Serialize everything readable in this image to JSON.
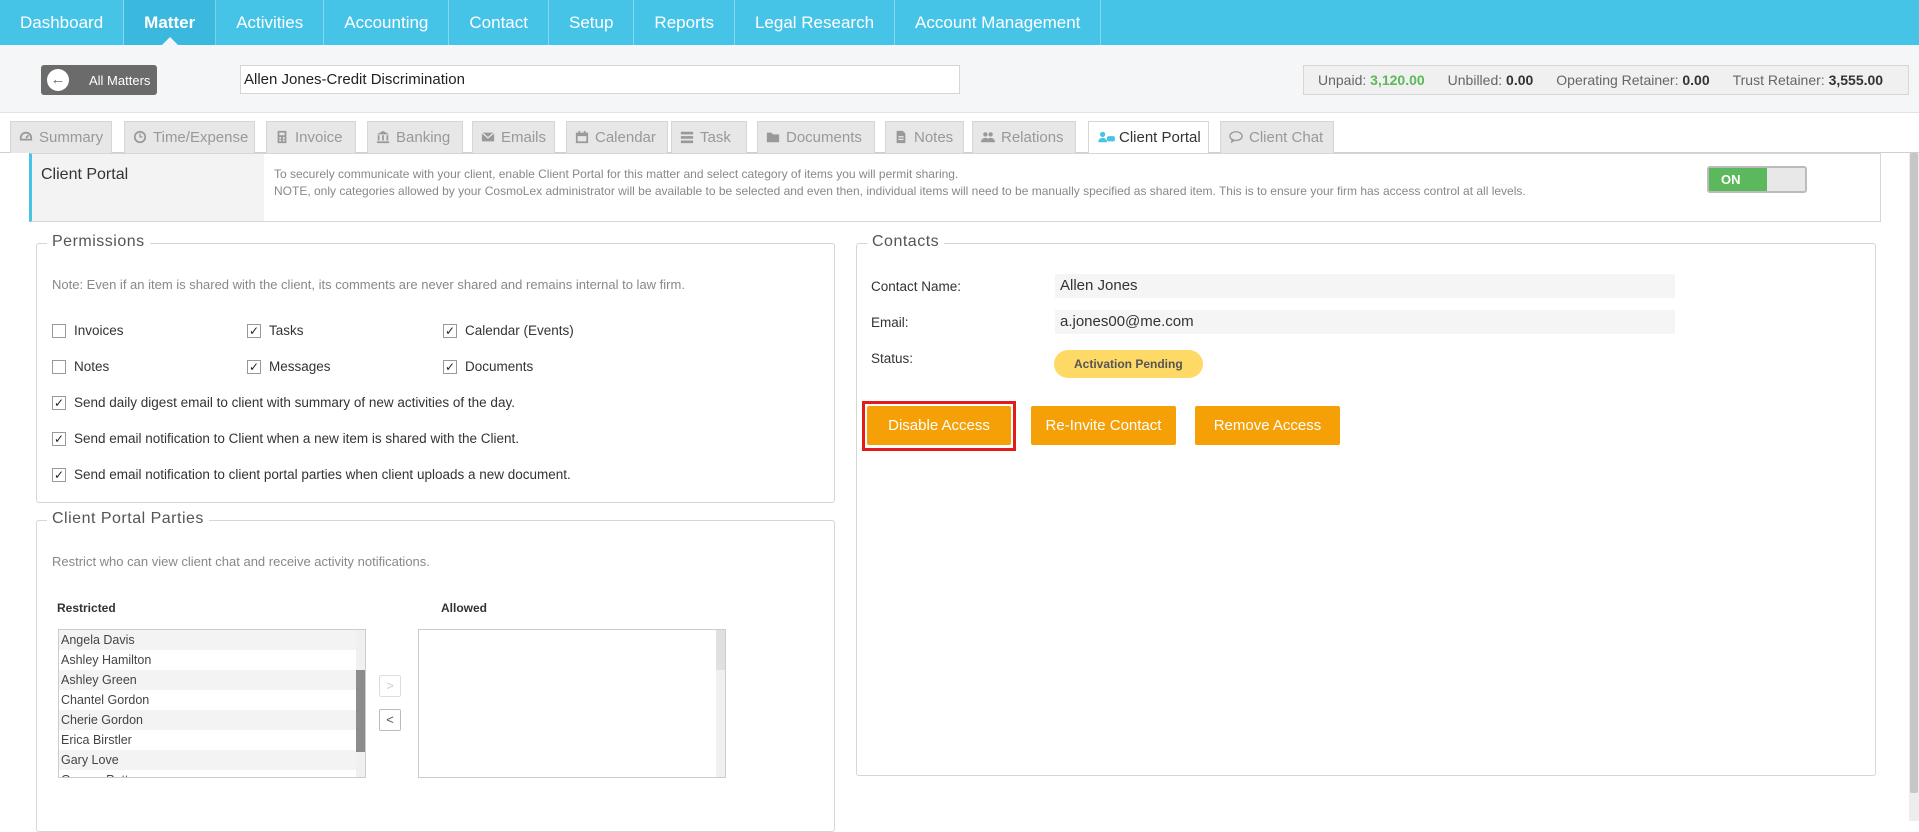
{
  "topnav": {
    "items": [
      {
        "label": "Dashboard"
      },
      {
        "label": "Matter"
      },
      {
        "label": "Activities"
      },
      {
        "label": "Accounting"
      },
      {
        "label": "Contact"
      },
      {
        "label": "Setup"
      },
      {
        "label": "Reports"
      },
      {
        "label": "Legal Research"
      },
      {
        "label": "Account Management"
      }
    ],
    "active": "Matter"
  },
  "matterbar": {
    "all_matters_label": "All Matters",
    "matter_name": "Allen Jones-Credit Discrimination",
    "balances": {
      "unpaid_label": "Unpaid:",
      "unpaid_value": "3,120.00",
      "unbilled_label": "Unbilled:",
      "unbilled_value": "0.00",
      "operating_label": "Operating Retainer:",
      "operating_value": "0.00",
      "trust_label": "Trust Retainer:",
      "trust_value": "3,555.00"
    }
  },
  "tabs": [
    {
      "label": "Summary",
      "icon": "dashboard-icon"
    },
    {
      "label": "Time/Expense",
      "icon": "clock-icon"
    },
    {
      "label": "Invoice",
      "icon": "calculator-icon"
    },
    {
      "label": "Banking",
      "icon": "bank-icon"
    },
    {
      "label": "Emails",
      "icon": "envelope-icon"
    },
    {
      "label": "Calendar",
      "icon": "calendar-icon"
    },
    {
      "label": "Task",
      "icon": "tasks-icon"
    },
    {
      "label": "Documents",
      "icon": "folder-icon"
    },
    {
      "label": "Notes",
      "icon": "note-icon"
    },
    {
      "label": "Relations",
      "icon": "users-icon"
    },
    {
      "label": "Client Portal",
      "icon": "client-portal-icon"
    },
    {
      "label": "Client Chat",
      "icon": "chat-icon"
    }
  ],
  "client_portal": {
    "title": "Client Portal",
    "desc_line1": "To securely communicate with your client, enable Client Portal for this matter and select category of items you will permit sharing.",
    "desc_line2": "NOTE, only categories allowed by your CosmoLex administrator will be available to be selected and even then, individual items will need to be manually specified as shared item. This is to ensure your firm has access control at all levels.",
    "toggle_label": "ON",
    "toggle_on": true
  },
  "permissions": {
    "legend": "Permissions",
    "note": "Note: Even if an item is shared with the client, its comments are never shared and remains internal to law firm.",
    "grid": [
      {
        "label": "Invoices",
        "checked": false
      },
      {
        "label": "Tasks",
        "checked": true
      },
      {
        "label": "Calendar (Events)",
        "checked": true
      },
      {
        "label": "Notes",
        "checked": false
      },
      {
        "label": "Messages",
        "checked": true
      },
      {
        "label": "Documents",
        "checked": true
      }
    ],
    "options": [
      {
        "label": "Send daily digest email to client with summary of new activities of the day.",
        "checked": true
      },
      {
        "label": "Send email notification to Client when a new item is shared with the Client.",
        "checked": true
      },
      {
        "label": "Send email notification to client portal parties when client uploads a new document.",
        "checked": true
      }
    ]
  },
  "parties": {
    "legend": "Client Portal Parties",
    "note": "Restrict who can view client chat and receive activity notifications.",
    "restricted_label": "Restricted",
    "allowed_label": "Allowed",
    "restricted": [
      "Angela Davis",
      "Ashley Hamilton",
      "Ashley Green",
      "Chantel Gordon",
      "Cherie Gordon",
      "Erica Birstler",
      "Gary Love",
      "George Patterson"
    ],
    "allowed": [],
    "move_right": ">",
    "move_left": "<"
  },
  "contacts": {
    "legend": "Contacts",
    "name_label": "Contact Name:",
    "name_value": "Allen Jones",
    "email_label": "Email:",
    "email_value": "a.jones00@me.com",
    "status_label": "Status:",
    "status_value": "Activation Pending",
    "buttons": {
      "disable": "Disable Access",
      "reinvite": "Re-Invite Contact",
      "remove": "Remove Access"
    }
  },
  "colors": {
    "nav_bg": "#45c4e8",
    "button_orange": "#f5a007",
    "toggle_green": "#5cb85c",
    "highlight_red": "#e41b1b",
    "status_yellow": "#ffd966"
  }
}
